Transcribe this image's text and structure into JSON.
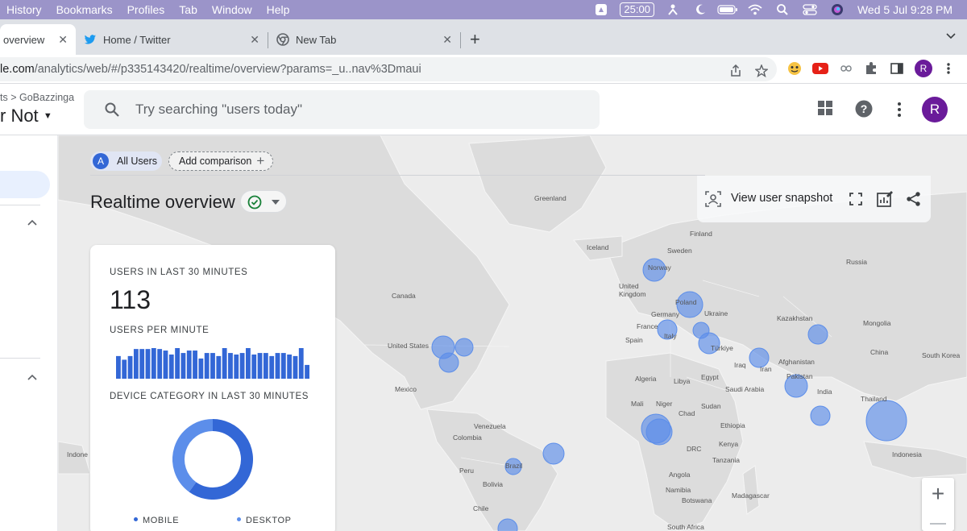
{
  "menubar": {
    "items": [
      "History",
      "Bookmarks",
      "Profiles",
      "Tab",
      "Window",
      "Help"
    ],
    "timer": "25:00",
    "clock": "Wed 5 Jul  9:28 PM",
    "icons": [
      "drive-icon",
      "timer-icon",
      "night-shift-icon",
      "moon-icon",
      "battery-icon",
      "wifi-icon",
      "spotlight-icon",
      "control-center-icon",
      "siri-icon"
    ]
  },
  "tabs": [
    {
      "title": "overview",
      "active": true
    },
    {
      "title": "Home / Twitter",
      "active": false,
      "icon": "twitter-icon"
    },
    {
      "title": "New Tab",
      "active": false,
      "icon": "chrome-icon"
    }
  ],
  "omnibox": {
    "url_host": "le.com",
    "url_path": "/analytics/web/#/p335143420/realtime/overview?params=_u..nav%3Dmaui"
  },
  "toolbar": {
    "avatar_letter": "R"
  },
  "header": {
    "breadcrumb_left": "ts",
    "breadcrumb_right": "GoBazzinga",
    "property_name": "r Not",
    "search_placeholder": "Try searching \"users today\"",
    "avatar_letter": "R"
  },
  "chips": {
    "all_users_badge": "A",
    "all_users": "All Users",
    "add_comparison": "Add comparison"
  },
  "page": {
    "title": "Realtime overview",
    "snapshot_label": "View user snapshot"
  },
  "card": {
    "users_heading": "USERS IN LAST 30 MINUTES",
    "users_value": "113",
    "per_minute_heading": "USERS PER MINUTE",
    "per_minute_bars": [
      0.74,
      0.62,
      0.74,
      0.97,
      0.97,
      0.97,
      1.0,
      0.97,
      0.92,
      0.79,
      1.0,
      0.84,
      0.92,
      0.92,
      0.66,
      0.84,
      0.84,
      0.74,
      1.0,
      0.84,
      0.79,
      0.84,
      1.0,
      0.79,
      0.84,
      0.84,
      0.74,
      0.84,
      0.84,
      0.79,
      0.74,
      1.0,
      0.45
    ],
    "device_heading": "DEVICE CATEGORY IN LAST 30 MINUTES",
    "device_split": {
      "mobile": 0.6,
      "desktop": 0.4
    },
    "legend_mobile": "MOBILE",
    "legend_desktop": "DESKTOP",
    "colors": {
      "mobile": "#3367d6",
      "desktop": "#5c8eea"
    }
  },
  "map_labels": [
    "Greenland",
    "Iceland",
    "Finland",
    "Sweden",
    "Norway",
    "Russia",
    "United Kingdom",
    "Poland",
    "Germany",
    "Ukraine",
    "France",
    "Italy",
    "Spain",
    "Türkiye",
    "Kazakhstan",
    "Mongolia",
    "China",
    "South Korea",
    "Afghanistan",
    "Iran",
    "Iraq",
    "Pakistan",
    "India",
    "Thailand",
    "Indonesia",
    "Canada",
    "United States",
    "Mexico",
    "Venezuela",
    "Colombia",
    "Peru",
    "Brazil",
    "Bolivia",
    "Chile",
    "Algeria",
    "Libya",
    "Egypt",
    "Saudi Arabia",
    "Mali",
    "Niger",
    "Chad",
    "Sudan",
    "Ethiopia",
    "DRC",
    "Kenya",
    "Tanzania",
    "Angola",
    "Namibia",
    "Botswana",
    "Madagascar",
    "South Africa",
    "Indone"
  ],
  "accent": "#4285f4"
}
